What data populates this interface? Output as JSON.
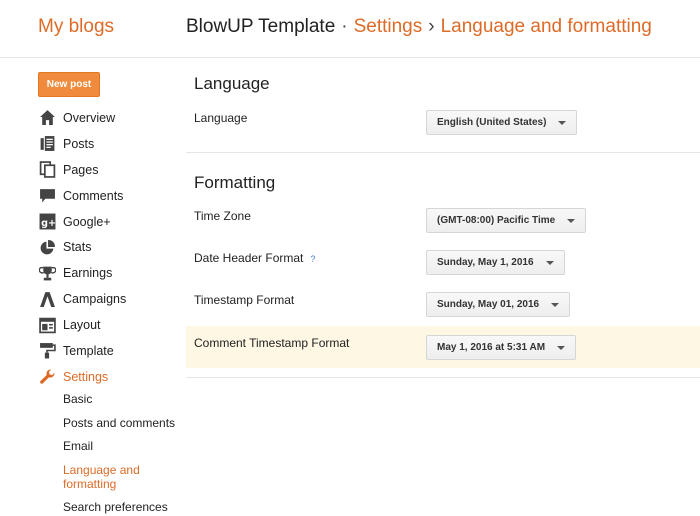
{
  "header": {
    "brand": "My blogs",
    "blog_name": "BlowUP Template",
    "separator_dot": "·",
    "section": "Settings",
    "separator_arrow": "›",
    "page": "Language and formatting"
  },
  "sidebar": {
    "new_post_label": "New post",
    "items": [
      {
        "label": "Overview",
        "icon": "home-icon"
      },
      {
        "label": "Posts",
        "icon": "posts-icon"
      },
      {
        "label": "Pages",
        "icon": "pages-icon"
      },
      {
        "label": "Comments",
        "icon": "comments-icon"
      },
      {
        "label": "Google+",
        "icon": "google-plus-icon"
      },
      {
        "label": "Stats",
        "icon": "stats-icon"
      },
      {
        "label": "Earnings",
        "icon": "trophy-icon"
      },
      {
        "label": "Campaigns",
        "icon": "campaigns-icon"
      },
      {
        "label": "Layout",
        "icon": "layout-icon"
      },
      {
        "label": "Template",
        "icon": "paint-roller-icon"
      },
      {
        "label": "Settings",
        "icon": "wrench-icon"
      }
    ],
    "sub_items": [
      "Basic",
      "Posts and comments",
      "Email",
      "Language and formatting",
      "Search preferences"
    ]
  },
  "language": {
    "section_title": "Language",
    "label": "Language",
    "value": "English (United States)"
  },
  "formatting": {
    "section_title": "Formatting",
    "time_zone_label": "Time Zone",
    "time_zone_value": "(GMT-08:00) Pacific Time",
    "date_header_label": "Date Header Format",
    "help_mark": "?",
    "date_header_value": "Sunday, May 1, 2016",
    "timestamp_label": "Timestamp Format",
    "timestamp_value": "Sunday, May 01, 2016",
    "comment_timestamp_label": "Comment Timestamp Format",
    "comment_timestamp_value": "May 1, 2016 at 5:31 AM"
  },
  "colors": {
    "accent": "#dd6b27",
    "button": "#f08a3c",
    "highlight_row": "#fdf7e3"
  }
}
